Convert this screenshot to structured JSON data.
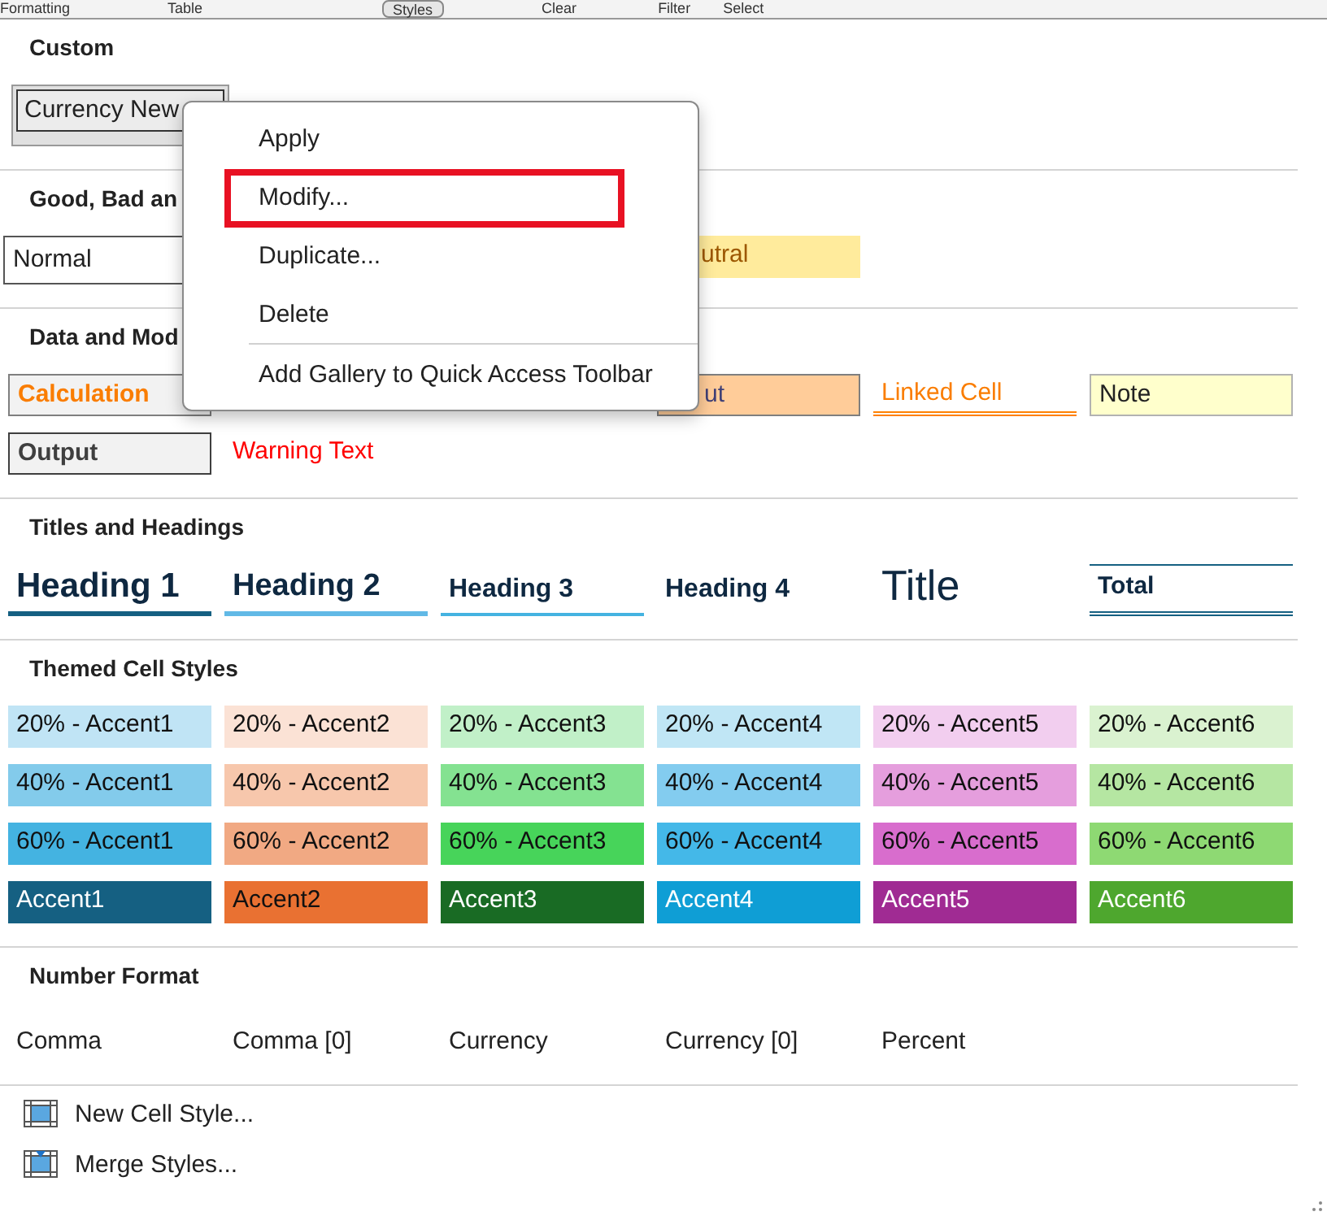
{
  "ribbon": [
    "Formatting",
    "Table",
    "Styles",
    "Clear",
    "Filter",
    "Select"
  ],
  "sections": [
    {
      "title": "Custom",
      "kind": "custom",
      "cells": [
        {
          "label": "Currency New",
          "kind": "custom",
          "selected": true
        }
      ]
    },
    {
      "title": "Good, Bad an",
      "kind": "styles",
      "cells": [
        {
          "label": "Normal",
          "kind": "normal"
        },
        {
          "label": "utral",
          "kind": "neutral"
        }
      ]
    },
    {
      "title": "Data and Mod",
      "kind": "styles",
      "cells": [
        {
          "label": "Calculation",
          "kind": "calculation"
        },
        {
          "label": "ut",
          "kind": "input"
        },
        {
          "label": "Linked Cell",
          "kind": "linked"
        },
        {
          "label": "Note",
          "kind": "note"
        },
        {
          "label": "Output",
          "kind": "output"
        },
        {
          "label": "Warning Text",
          "kind": "warning"
        }
      ]
    },
    {
      "title": "Titles and Headings",
      "kind": "styles",
      "cells": [
        {
          "label": "Heading 1",
          "kind": "heading1"
        },
        {
          "label": "Heading 2",
          "kind": "heading2"
        },
        {
          "label": "Heading 3",
          "kind": "heading3"
        },
        {
          "label": "Heading 4",
          "kind": "heading4"
        },
        {
          "label": "Title",
          "kind": "title"
        },
        {
          "label": "Total",
          "kind": "total"
        }
      ]
    },
    {
      "title": "Themed Cell Styles",
      "kind": "themed",
      "cells": [
        {
          "label": "20% - Accent1",
          "color": "#c0e4f5"
        },
        {
          "label": "20% - Accent2",
          "color": "#fbe2d5"
        },
        {
          "label": "20% - Accent3",
          "color": "#c1f0c8"
        },
        {
          "label": "20% - Accent4",
          "color": "#c0e6f5"
        },
        {
          "label": "20% - Accent5",
          "color": "#f2ceef"
        },
        {
          "label": "20% - Accent6",
          "color": "#daf2d0"
        },
        {
          "label": "40% - Accent1",
          "color": "#83cbeb"
        },
        {
          "label": "40% - Accent2",
          "color": "#f7c7ac"
        },
        {
          "label": "40% - Accent3",
          "color": "#84e291"
        },
        {
          "label": "40% - Accent4",
          "color": "#83ccef"
        },
        {
          "label": "40% - Accent5",
          "color": "#e59edd"
        },
        {
          "label": "40% - Accent6",
          "color": "#b5e6a2"
        },
        {
          "label": "60% - Accent1",
          "color": "#44b3e1"
        },
        {
          "label": "60% - Accent2",
          "color": "#f1a983"
        },
        {
          "label": "60% - Accent3",
          "color": "#47d45a"
        },
        {
          "label": "60% - Accent4",
          "color": "#44b8e8"
        },
        {
          "label": "60% - Accent5",
          "color": "#d86dcd"
        },
        {
          "label": "60% - Accent6",
          "color": "#8ed973"
        },
        {
          "label": "Accent1",
          "color": "#156082"
        },
        {
          "label": "Accent2",
          "color": "#e97132"
        },
        {
          "label": "Accent3",
          "color": "#196b24"
        },
        {
          "label": "Accent4",
          "color": "#0f9ed5"
        },
        {
          "label": "Accent5",
          "color": "#a02b93"
        },
        {
          "label": "Accent6",
          "color": "#4ea72e"
        }
      ]
    },
    {
      "title": "Number Format",
      "kind": "plain",
      "cells": [
        {
          "label": "Comma"
        },
        {
          "label": "Comma [0]"
        },
        {
          "label": "Currency"
        },
        {
          "label": "Currency [0]"
        },
        {
          "label": "Percent"
        }
      ]
    }
  ],
  "commands": [
    {
      "label": "New Cell Style...",
      "kind": "new"
    },
    {
      "label": "Merge Styles...",
      "kind": "merge"
    }
  ],
  "context_menu": {
    "items": [
      {
        "label": "Apply",
        "highlighted": false
      },
      {
        "label": "Modify...",
        "highlighted": true
      },
      {
        "label": "Duplicate...",
        "highlighted": false
      },
      {
        "label": "Delete",
        "highlighted": false,
        "divider_after": true
      },
      {
        "label": "Add Gallery to Quick Access Toolbar",
        "highlighted": false
      }
    ]
  }
}
